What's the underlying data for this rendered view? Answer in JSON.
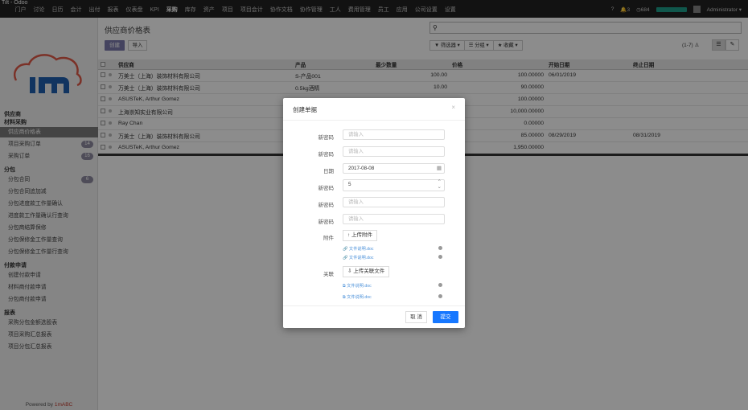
{
  "window": {
    "pretitle": "Tilt - Odoo"
  },
  "topnav": {
    "items": [
      "门户",
      "讨论",
      "日历",
      "会计",
      "出付",
      "报表",
      "仪表盘",
      "KPI",
      "采购",
      "库存",
      "资产",
      "项目",
      "项目会计",
      "协作文档",
      "协作管理",
      "工人",
      "费用管理",
      "员工",
      "应用",
      "公司设置",
      "设置"
    ],
    "active_index": 8,
    "help": "?",
    "bell_count": "3",
    "clock_count": "684",
    "user": "Administrator ▾"
  },
  "sidebar": {
    "sec1": "供应商",
    "sec2": "材料采购",
    "items1": [
      {
        "label": "供应商价格表",
        "active": true
      },
      {
        "label": "项目采购订单",
        "badge": "14"
      },
      {
        "label": "采购订单",
        "badge": "16"
      }
    ],
    "sec3": "分包",
    "items2": [
      {
        "label": "分包合同",
        "badge": "6"
      },
      {
        "label": "分包合同追加减"
      },
      {
        "label": "分包进度款工作量确认"
      },
      {
        "label": "进度款工作量确认行查询"
      },
      {
        "label": "分包商结算保修"
      },
      {
        "label": "分包保修金工作量查询"
      },
      {
        "label": "分包保修金工作量行查询"
      }
    ],
    "sec4": "付款申请",
    "items3": [
      {
        "label": "创建付款申请"
      },
      {
        "label": "材料商付款申请"
      },
      {
        "label": "分包商付款申请"
      }
    ],
    "sec5": "报表",
    "items4": [
      {
        "label": "采购分包金额选股表"
      },
      {
        "label": "项目采购汇总报表"
      },
      {
        "label": "项目分包汇总报表"
      }
    ],
    "powered_prefix": "Powered by",
    "powered_brand": "1mABC"
  },
  "main": {
    "title": "供应商价格表",
    "create": "创建",
    "import": "导入",
    "search_placeholder": "",
    "filters": [
      "▼ 筛选器 ▾",
      "☰ 分组 ▾",
      "★ 收藏 ▾"
    ],
    "pager": "(1-7)",
    "columns": [
      "供应商",
      "产品",
      "最少数量",
      "价格",
      "开始日期",
      "终止日期"
    ],
    "rows": [
      {
        "vendor": "万美士（上海）装饰材料有限公司",
        "product": "S-产品001",
        "qty": "100.00",
        "price": "100.00000",
        "start": "06/01/2019",
        "end": ""
      },
      {
        "vendor": "万美士（上海）装饰材料有限公司",
        "product": "0.5kg酒精",
        "qty": "10.00",
        "price": "90.00000",
        "start": "",
        "end": ""
      },
      {
        "vendor": "ASUSTeK, Arthur Gomez",
        "product": "",
        "qty": "",
        "price": "100.00000",
        "start": "",
        "end": ""
      },
      {
        "vendor": "上海崇知实业有限公司",
        "product": "",
        "qty": "",
        "price": "10,000.00000",
        "start": "",
        "end": ""
      },
      {
        "vendor": "Ray Chan",
        "product": "",
        "qty": "5.00",
        "price": "0.00000",
        "start": "",
        "end": ""
      },
      {
        "vendor": "万美士（上海）装饰材料有限公司",
        "product": "",
        "qty": "2.00",
        "price": "85.00000",
        "start": "08/29/2019",
        "end": "08/31/2019"
      },
      {
        "vendor": "ASUSTeK, Arthur Gomez",
        "product": "",
        "qty": "1.00",
        "price": "1,950.00000",
        "start": "",
        "end": ""
      }
    ]
  },
  "modal": {
    "title": "创建单据",
    "close": "×",
    "fields": [
      {
        "label": "新密码",
        "value": "",
        "placeholder": "请输入"
      },
      {
        "label": "新密码",
        "value": "",
        "placeholder": "请输入"
      },
      {
        "label": "日期",
        "value": "2017-08-08",
        "placeholder": ""
      },
      {
        "label": "新密码",
        "value": "5",
        "placeholder": ""
      },
      {
        "label": "新密码",
        "value": "",
        "placeholder": "请输入"
      },
      {
        "label": "新密码",
        "value": "",
        "placeholder": "请输入"
      }
    ],
    "attach_label": "附件",
    "attach_button": "↑ 上传附件",
    "attach_files": [
      "文件说明.doc",
      "文件说明.doc"
    ],
    "related_label": "关联",
    "related_button": "⇩ 上传关联文件",
    "related_files": [
      "文件说明.doc",
      "文件说明.doc"
    ],
    "cancel": "取 消",
    "submit": "提交"
  }
}
